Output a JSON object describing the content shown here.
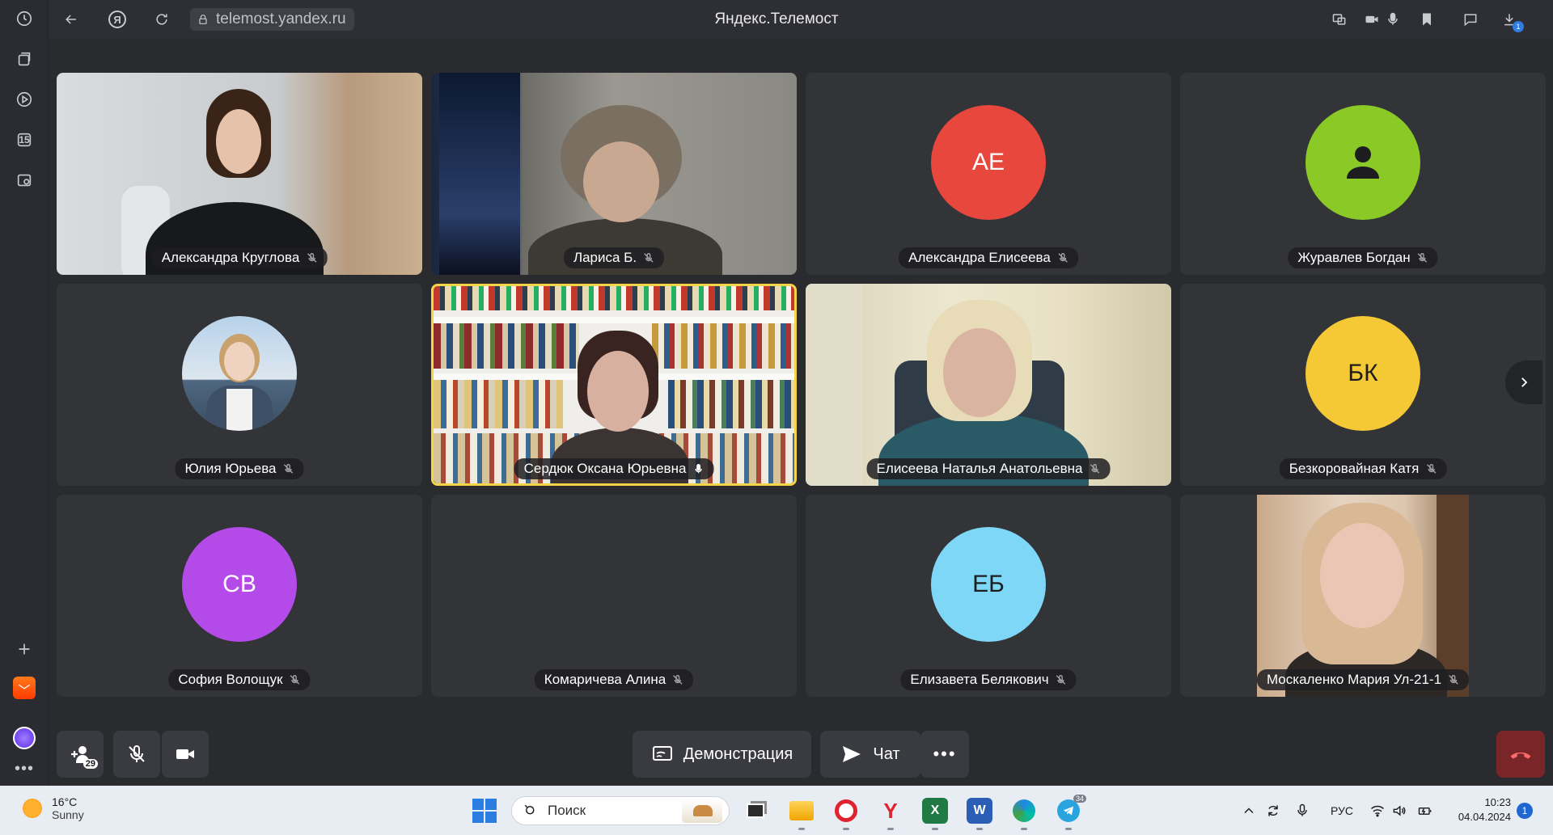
{
  "browser": {
    "url": "telemost.yandex.ru",
    "title": "Яндекс.Телемост",
    "download_badge": "1"
  },
  "sidebar": {
    "calendar_day": "15"
  },
  "participants": [
    {
      "name": "Александра Круглова",
      "mic": "muted",
      "type": "video"
    },
    {
      "name": "Лариса Б.",
      "mic": "muted",
      "type": "video"
    },
    {
      "name": "Александра Елисеева",
      "mic": "muted",
      "type": "avatar",
      "initials": "АЕ",
      "color": "#e8473e"
    },
    {
      "name": "Журавлев Богдан",
      "mic": "muted",
      "type": "avatar-icon",
      "color": "#8ac926"
    },
    {
      "name": "Юлия Юрьева",
      "mic": "muted",
      "type": "photo"
    },
    {
      "name": "Сердюк Оксана Юрьевна",
      "mic": "on",
      "type": "video",
      "active": true
    },
    {
      "name": "Елисеева Наталья Анатольевна",
      "mic": "muted",
      "type": "video"
    },
    {
      "name": "Безкоровайная Катя",
      "mic": "muted",
      "type": "avatar",
      "initials": "БК",
      "color": "#f4c935"
    },
    {
      "name": "София Волощук",
      "mic": "muted",
      "type": "avatar",
      "initials": "СВ",
      "color": "#b44be8"
    },
    {
      "name": "Комаричева Алина",
      "mic": "muted",
      "type": "empty"
    },
    {
      "name": "Елизавета Белякович",
      "mic": "muted",
      "type": "avatar",
      "initials": "ЕБ",
      "color": "#7fd7f7"
    },
    {
      "name": "Москаленко Мария Ул-21-1",
      "mic": "muted",
      "type": "video"
    }
  ],
  "controls": {
    "participants_count": "29",
    "demo_label": "Демонстрация",
    "chat_label": "Чат"
  },
  "taskbar": {
    "temperature": "16°C",
    "weather": "Sunny",
    "search_placeholder": "Поиск",
    "language": "РУС",
    "time": "10:23",
    "date": "04.04.2024",
    "notifications": "1",
    "telegram_badge": "34"
  }
}
